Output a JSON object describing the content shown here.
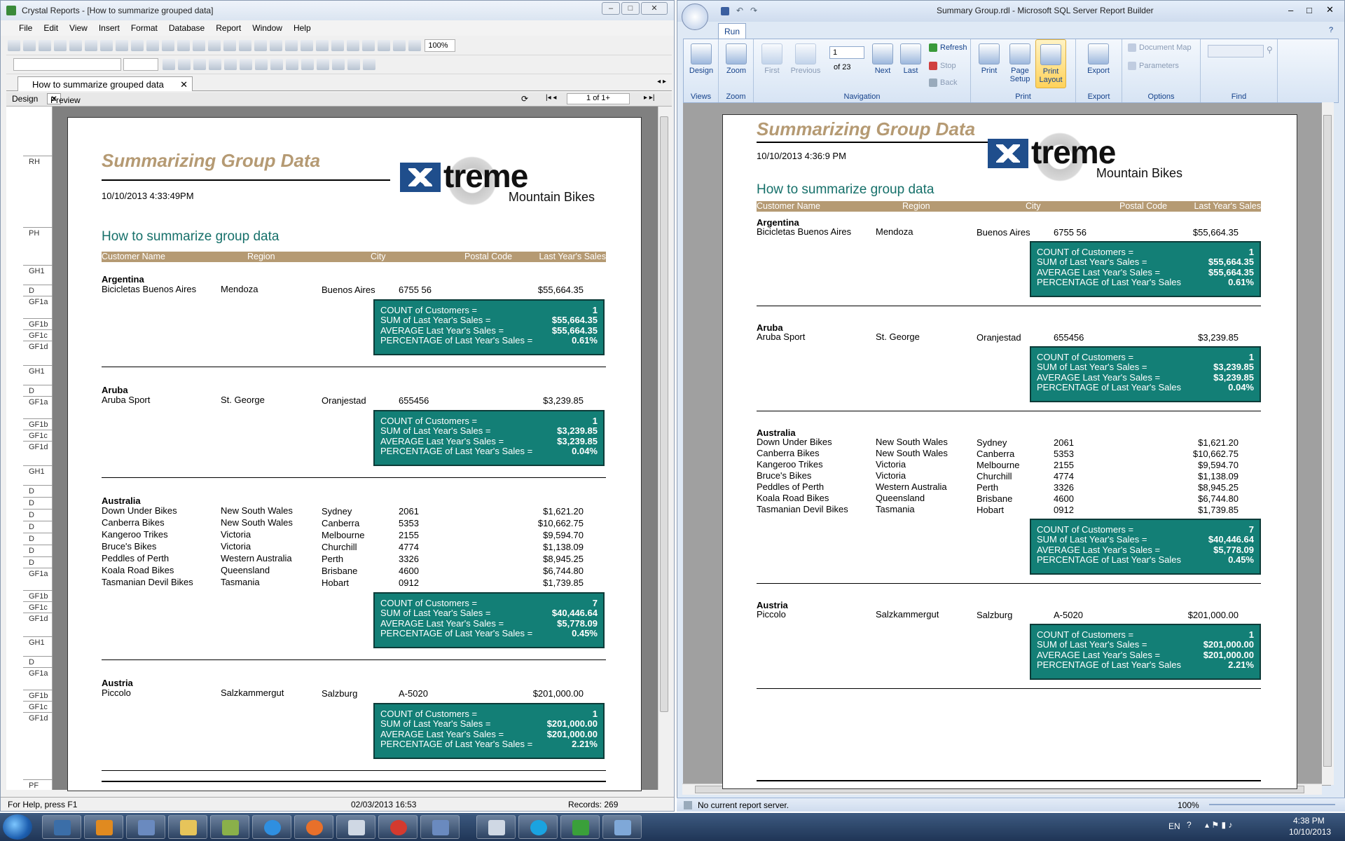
{
  "left_window": {
    "title": "Crystal Reports - [How to summarize grouped data]",
    "menu": [
      "File",
      "Edit",
      "View",
      "Insert",
      "Format",
      "Database",
      "Report",
      "Window",
      "Help"
    ],
    "zoom": "100%",
    "doc_tab": "How to summarize grouped data",
    "views": {
      "design": "Design",
      "preview": "Preview"
    },
    "page_nav": "1 of 1+",
    "sections": [
      "RH",
      "PH",
      "GH1",
      "D",
      "GF1a",
      "GF1b",
      "GF1c",
      "GF1d",
      "GH1",
      "D",
      "GF1a",
      "GF1b",
      "GF1c",
      "GF1d",
      "GH1",
      "D",
      "D",
      "D",
      "D",
      "D",
      "D",
      "D",
      "GF1a",
      "GF1b",
      "GF1c",
      "GF1d",
      "GH1",
      "D",
      "GF1a",
      "GF1b",
      "GF1c",
      "GF1d",
      "PF"
    ],
    "status": {
      "help": "For Help, press F1",
      "date": "02/03/2013  16:53",
      "records": "Records:  269"
    },
    "report": {
      "date": "10/10/2013    4:33:49PM"
    }
  },
  "right_window": {
    "title": "Summary Group.rdl - Microsoft SQL Server Report Builder",
    "run_tab": "Run",
    "ribbon": {
      "views_group": "Views",
      "design": "Design",
      "zoom_group": "Zoom",
      "zoom": "Zoom",
      "nav_group": "Navigation",
      "first": "First",
      "previous": "Previous",
      "page_input": "1",
      "of_pages": "of  23",
      "next": "Next",
      "last": "Last",
      "refresh": "Refresh",
      "stop": "Stop",
      "back": "Back",
      "print_group": "Print",
      "print": "Print",
      "page_setup": "Page Setup",
      "print_layout": "Print Layout",
      "export_group": "Export",
      "export": "Export",
      "options_group": "Options",
      "document_map": "Document Map",
      "parameters": "Parameters",
      "find_group": "Find"
    },
    "status": {
      "server": "No current report server.",
      "zoom": "100%"
    },
    "report": {
      "date": "10/10/2013  4:36:9 PM"
    }
  },
  "report": {
    "title": "Summarizing Group Data",
    "subtitle": "How to summarize group data",
    "logo": {
      "text": "treme",
      "tagline": "Mountain Bikes"
    },
    "columns": [
      "Customer Name",
      "Region",
      "City",
      "Postal Code",
      "Last Year's Sales"
    ],
    "labels": {
      "count": "COUNT of Customers =",
      "sum": "SUM of Last Year's Sales =",
      "avg": "AVERAGE Last Year's Sales =",
      "pct": "PERCENTAGE of Last Year's Sales ="
    },
    "labels_rb": {
      "count": "COUNT of Customers =",
      "sum": "SUM of Last Year's Sales =",
      "avg": "AVERAGE Last Year's Sales =",
      "pct": "PERCENTAGE of Last Year's Sales"
    },
    "groups": [
      {
        "country": "Argentina",
        "rows": [
          [
            "Bicicletas Buenos Aires",
            "Mendoza",
            "Buenos Aires",
            "6755 56",
            "$55,664.35"
          ]
        ],
        "count": "1",
        "sum": "$55,664.35",
        "avg": "$55,664.35",
        "pct": "0.61%"
      },
      {
        "country": "Aruba",
        "rows": [
          [
            "Aruba Sport",
            "St. George",
            "Oranjestad",
            "655456",
            "$3,239.85"
          ]
        ],
        "count": "1",
        "sum": "$3,239.85",
        "avg": "$3,239.85",
        "pct": "0.04%"
      },
      {
        "country": "Australia",
        "rows": [
          [
            "Down Under Bikes",
            "New South Wales",
            "Sydney",
            "2061",
            "$1,621.20"
          ],
          [
            "Canberra Bikes",
            "New South Wales",
            "Canberra",
            "5353",
            "$10,662.75"
          ],
          [
            "Kangeroo Trikes",
            "Victoria",
            "Melbourne",
            "2155",
            "$9,594.70"
          ],
          [
            "Bruce's Bikes",
            "Victoria",
            "Churchill",
            "4774",
            "$1,138.09"
          ],
          [
            "Peddles of Perth",
            "Western Australia",
            "Perth",
            "3326",
            "$8,945.25"
          ],
          [
            "Koala Road Bikes",
            "Queensland",
            "Brisbane",
            "4600",
            "$6,744.80"
          ],
          [
            "Tasmanian Devil Bikes",
            "Tasmania",
            "Hobart",
            "0912",
            "$1,739.85"
          ]
        ],
        "count": "7",
        "sum": "$40,446.64",
        "avg": "$5,778.09",
        "pct": "0.45%"
      },
      {
        "country": "Austria",
        "rows": [
          [
            "Piccolo",
            "Salzkammergut",
            "Salzburg",
            "A-5020",
            "$201,000.00"
          ]
        ],
        "count": "1",
        "sum": "$201,000.00",
        "avg": "$201,000.00",
        "pct": "2.21%"
      }
    ]
  },
  "taskbar": {
    "lang": "EN",
    "time": "4:38 PM",
    "date": "10/10/2013"
  }
}
